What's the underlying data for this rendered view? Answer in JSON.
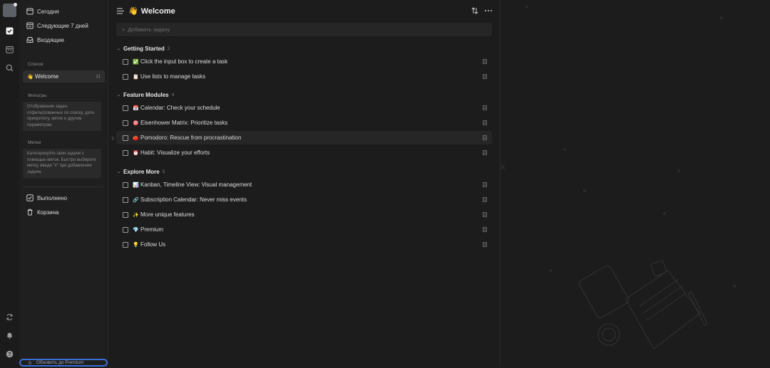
{
  "sidebar": {
    "nav": [
      "Сегодня",
      "Следующие 7 дней",
      "Входящие"
    ],
    "list_section": "Список",
    "lists": [
      {
        "emoji": "👋",
        "name": "Welcome",
        "count": "11"
      }
    ],
    "filters_title": "Фильтры",
    "filters_hint": "Отображение задач, отфильтрованных по списку, дате, приоритету, метке и другим параметрам.",
    "tags_title": "Метки",
    "tags_hint": "Категоризуйте свои задачи с помощью меток. Быстро выберите метку, введя \"#\" при добавлении задачи.",
    "done": "Выполнено",
    "trash": "Корзина",
    "upgrade": "Обновить до Premium"
  },
  "main": {
    "title_emoji": "👋",
    "title": "Welcome",
    "add_placeholder": "Добавить задачу",
    "groups": [
      {
        "name": "Getting Started",
        "count": "2",
        "tasks": [
          {
            "emoji": "✅",
            "name": "Click the input box to create a task"
          },
          {
            "emoji": "📋",
            "name": "Use lists to manage tasks"
          }
        ]
      },
      {
        "name": "Feature Modules",
        "count": "4",
        "tasks": [
          {
            "emoji": "📅",
            "name": "Calendar: Check your schedule"
          },
          {
            "emoji": "🎯",
            "name": "Eisenhower Matrix: Prioritize tasks"
          },
          {
            "emoji": "🍅",
            "name": "Pomodoro: Rescue from procrastination"
          },
          {
            "emoji": "⏰",
            "name": "Habit: Visualize your efforts"
          }
        ]
      },
      {
        "name": "Explore More",
        "count": "5",
        "tasks": [
          {
            "emoji": "📊",
            "name": "Kanban, Timeline View: Visual management"
          },
          {
            "emoji": "🔗",
            "name": "Subscription Calendar: Never miss events"
          },
          {
            "emoji": "✨",
            "name": "More unique features"
          },
          {
            "emoji": "💎",
            "name": "Premium"
          },
          {
            "emoji": "💡",
            "name": "Follow Us"
          }
        ]
      }
    ]
  },
  "colors": {
    "accent": "#3a6ed8",
    "bg": "#1c1c1c",
    "sidebar": "#1f1f1f",
    "selected": "#2e2e2e"
  }
}
